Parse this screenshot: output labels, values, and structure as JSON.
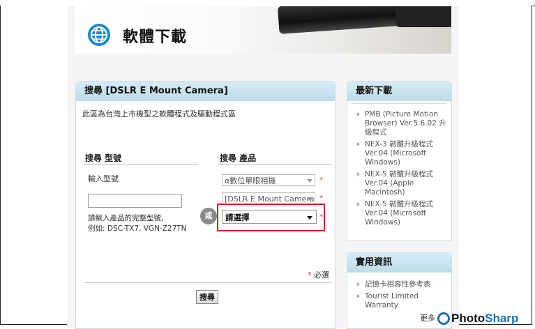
{
  "banner": {
    "title": "軟體下載"
  },
  "search_panel": {
    "title": "搜尋 [DSLR E Mount Camera]",
    "description": "此區為台灣上市機型之軟體程式及驅動程式區",
    "model_col": {
      "title": "搜尋 型號",
      "input_label": "輸入型號",
      "input_value": "",
      "hint_line1": "請輸入產品的完整型號,",
      "hint_line2": "例如: DSC-TX7, VGN-Z27TN"
    },
    "or_label": "或",
    "product_col": {
      "title": "搜尋 產品",
      "select1": "α數位單眼相機",
      "select2": "[DSLR E Mount Camera",
      "select3": "請選擇",
      "star": "*"
    },
    "required_star": "*",
    "required_text": "必選",
    "search_button": "搜尋"
  },
  "latest": {
    "title": "最新下載",
    "items": [
      "PMB (Picture Motion Browser) Ver.5.6.02 升級程式",
      "NEX-3 韌體升級程式 Ver.04 (Microsoft Windows)",
      "NEX-5 韌體升級程式 Ver.04 (Apple Macintosh)",
      "NEX-5 韌體升級程式 Ver.04 (Microsoft Windows)"
    ]
  },
  "useful": {
    "title": "實用資訊",
    "items": [
      "記憶卡相容性參考表",
      "Tourist Limited Warranty"
    ]
  },
  "footer": {
    "more": "更多",
    "logo_a": "Photo",
    "logo_b": "Sharp"
  },
  "colors": {
    "panel_header": "#bcdce9",
    "highlight": "#d0202a",
    "logo_blue": "#1d6fb8"
  }
}
